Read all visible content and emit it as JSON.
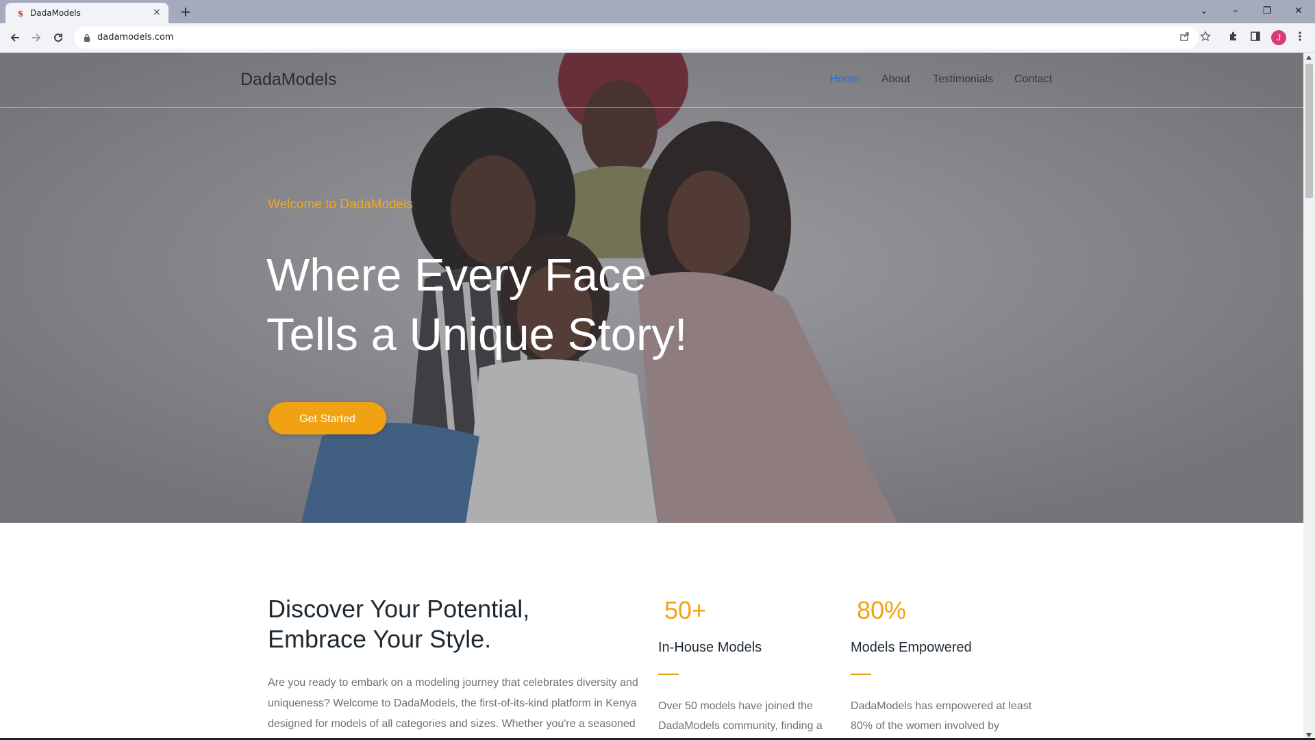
{
  "browser": {
    "tab_title": "DadaModels",
    "tab_favicon": "$",
    "tab_close": "×",
    "new_tab": "+",
    "url": "dadamodels.com",
    "profile_initial": "J",
    "icons": {
      "back": "back-arrow-icon",
      "forward": "forward-arrow-icon",
      "reload": "reload-icon",
      "share": "share-icon",
      "bookmark": "star-icon",
      "extensions": "puzzle-icon",
      "side_panel": "side-panel-icon",
      "menu": "kebab-menu-icon"
    },
    "window": {
      "tab_search": "⌄",
      "minimize": "–",
      "restore": "❐",
      "close": "✕"
    }
  },
  "site": {
    "logo": "DadaModels",
    "nav": [
      {
        "label": "Home",
        "active": true
      },
      {
        "label": "About",
        "active": false
      },
      {
        "label": "Testimonials",
        "active": false
      },
      {
        "label": "Contact",
        "active": false
      }
    ]
  },
  "hero": {
    "eyebrow": "Welcome to DadaModels",
    "title_line1": "Where Every Face",
    "title_line2": "Tells a Unique Story!",
    "cta_label": "Get Started"
  },
  "about": {
    "title_line1": "Discover Your Potential,",
    "title_line2": "Embrace Your Style.",
    "body": "Are you ready to embark on a modeling journey that celebrates diversity and uniqueness? Welcome to DadaModels, the first-of-its-kind platform in Kenya designed for models of all categories and sizes. Whether you're a seasoned"
  },
  "stats": [
    {
      "number": "50+",
      "label": "In-House Models",
      "body": "Over 50 models have joined the DadaModels community, finding a"
    },
    {
      "number": "80%",
      "label": "Models Empowered",
      "body": "DadaModels has empowered at least 80% of the women involved by"
    }
  ],
  "colors": {
    "accent": "#f0a212",
    "nav_active": "#2b6fd1",
    "heading": "#1f2a33",
    "body_text": "#6b7178"
  }
}
